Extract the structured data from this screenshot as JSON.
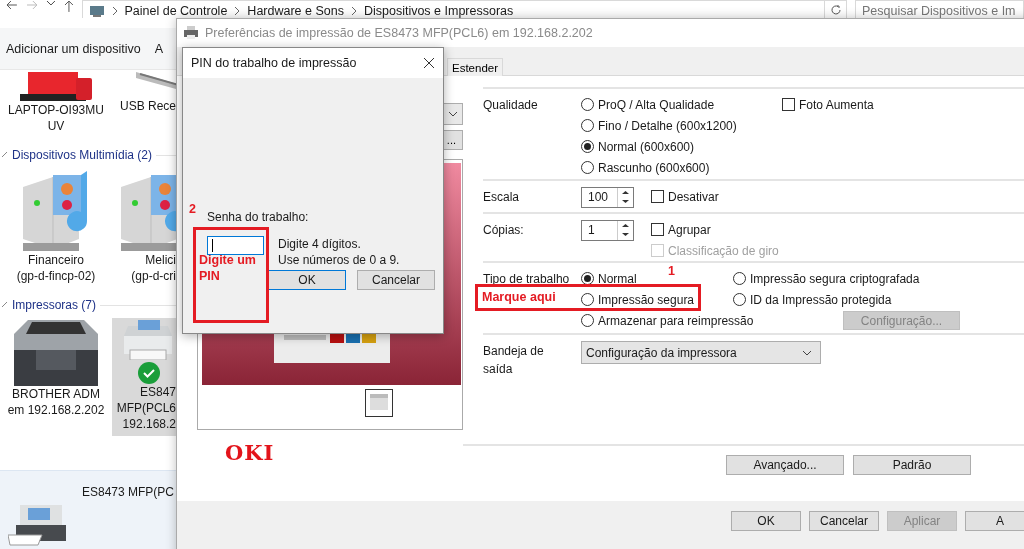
{
  "explorer": {
    "breadcrumb": [
      "Painel de Controle",
      "Hardware e Sons",
      "Dispositivos e Impressoras"
    ],
    "search": {
      "placeholder": "Pesquisar Dispositivos e Im"
    },
    "toolbar": [
      "Adicionar um dispositivo",
      "A"
    ],
    "top_items": [
      {
        "kind": "laptop",
        "lines": [
          "LAPTOP-OI93MU",
          "UV"
        ]
      },
      {
        "kind": "keyboard",
        "lines": [
          "USB Rece"
        ]
      }
    ],
    "groups": [
      {
        "title": "Dispositivos Multimídia (2)",
        "items": [
          {
            "kind": "media",
            "lines": [
              "Financeiro",
              "(gp-d-fincp-02)"
            ],
            "selected": false,
            "default": false
          },
          {
            "kind": "media",
            "lines": [
              "Melici",
              "(gp-d-cri"
            ],
            "selected": false,
            "default": false
          }
        ]
      },
      {
        "title": "Impressoras (7)",
        "items": [
          {
            "kind": "laser",
            "lines": [
              "BROTHER ADM",
              "em 192.168.2.202"
            ],
            "selected": false,
            "default": false
          },
          {
            "kind": "mfp",
            "lines": [
              "ES847",
              "MFP(PCL6",
              "192.168.2"
            ],
            "selected": true,
            "default": true
          }
        ]
      }
    ],
    "details": {
      "name": "ES8473 MFP(PC"
    }
  },
  "preferences": {
    "title": "Preferências de impressão de ES8473 MFP(PCL6) em 192.168.2.202",
    "tabs": [
      {
        "label": "Estender",
        "selected": false
      }
    ],
    "preview_button": "...",
    "quality": {
      "label": "Qualidade",
      "options": [
        {
          "label": "ProQ / Alta Qualidade",
          "selected": false
        },
        {
          "label": "Fino / Detalhe (600x1200)",
          "selected": false
        },
        {
          "label": "Normal (600x600)",
          "selected": true
        },
        {
          "label": "Rascunho (600x600)",
          "selected": false
        }
      ],
      "photo": {
        "label": "Foto Aumenta",
        "checked": false
      }
    },
    "scale": {
      "label": "Escala",
      "value": "100",
      "checkboxes": [
        {
          "label": "Desativar",
          "checked": false,
          "disabled": false
        }
      ]
    },
    "copies": {
      "label": "Cópias:",
      "value": "1",
      "checkboxes": [
        {
          "label": "Agrupar",
          "checked": false,
          "disabled": false
        },
        {
          "label": "Classificação de giro",
          "checked": false,
          "disabled": true
        }
      ]
    },
    "job_type": {
      "label": "Tipo de trabalho",
      "options": [
        {
          "label": "Normal",
          "selected": true
        },
        {
          "label": "Impressão segura criptografada",
          "selected": false
        },
        {
          "label": "Impressão segura",
          "selected": false
        },
        {
          "label": "ID da Impressão protegida",
          "selected": false
        },
        {
          "label": "Armazenar para reimpressão",
          "selected": false
        }
      ],
      "config_button": {
        "label": "Configuração...",
        "disabled": true
      }
    },
    "tray": {
      "label": "Bandeja de saída",
      "value": "Configuração da impressora"
    },
    "logo": "OKI",
    "actions": [
      "Avançado...",
      "Padrão"
    ],
    "buttons": [
      {
        "label": "OK",
        "disabled": false
      },
      {
        "label": "Cancelar",
        "disabled": false
      },
      {
        "label": "Aplicar",
        "disabled": true
      },
      {
        "label": "A",
        "disabled": false
      }
    ]
  },
  "pin_dialog": {
    "title": "PIN do trabalho de impressão",
    "field_label": "Senha do trabalho:",
    "field": {
      "focused": true
    },
    "hints": [
      "Digite 4 dígitos.",
      "Use números de 0 a 9."
    ],
    "buttons": [
      {
        "label": "OK",
        "default": true
      },
      {
        "label": "Cancelar",
        "default": false
      }
    ]
  },
  "annotations": [
    {
      "kind": "pin",
      "number": "2",
      "text": "Digite um PIN"
    },
    {
      "kind": "job",
      "number": "1",
      "text": "Marque aqui"
    }
  ]
}
